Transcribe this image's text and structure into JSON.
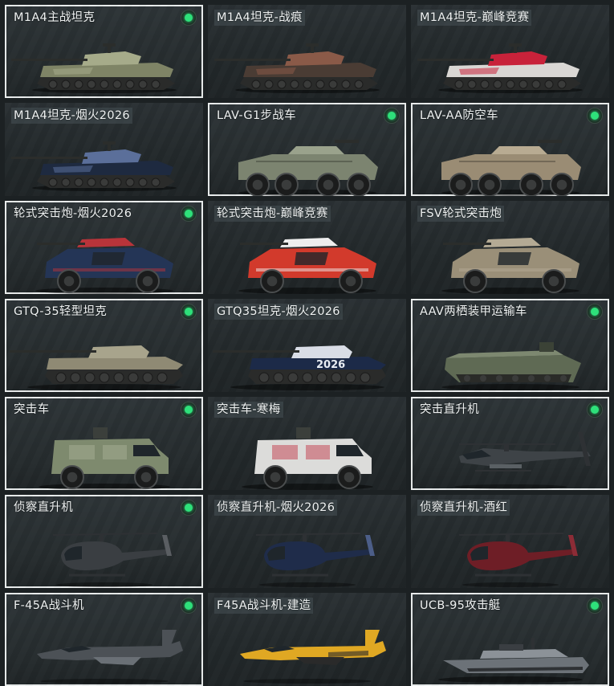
{
  "cards": [
    {
      "name": "M1A4主战坦克",
      "owned": true,
      "type": "tank",
      "color": "#7f8466",
      "accent": "#a6ab8a"
    },
    {
      "name": "M1A4坦克-战痕",
      "owned": false,
      "type": "tank",
      "color": "#4a3c34",
      "accent": "#8a5a48"
    },
    {
      "name": "M1A4坦克-巅峰竞赛",
      "owned": false,
      "type": "tank",
      "color": "#d9d7d4",
      "accent": "#c8223a"
    },
    {
      "name": "M1A4坦克-烟火2026",
      "owned": false,
      "type": "tank",
      "color": "#1e2a40",
      "accent": "#5b6f9a"
    },
    {
      "name": "LAV-G1步战车",
      "owned": true,
      "type": "apc8",
      "color": "#7c8470",
      "accent": "#9aa28c"
    },
    {
      "name": "LAV-AA防空车",
      "owned": true,
      "type": "apc8",
      "color": "#9a8c74",
      "accent": "#b8ab92"
    },
    {
      "name": "轮式突击炮-烟火2026",
      "owned": true,
      "type": "car4",
      "color": "#243556",
      "accent": "#b8343a"
    },
    {
      "name": "轮式突击炮-巅峰竞赛",
      "owned": false,
      "type": "car4",
      "color": "#d23a2c",
      "accent": "#eeeeee"
    },
    {
      "name": "FSV轮式突击炮",
      "owned": false,
      "type": "car4",
      "color": "#9a8f78",
      "accent": "#b4aa94"
    },
    {
      "name": "GTQ-35轻型坦克",
      "owned": true,
      "type": "lighttank",
      "color": "#8f8a74",
      "accent": "#a8a48c"
    },
    {
      "name": "GTQ35坦克-烟火2026",
      "owned": false,
      "type": "lighttank",
      "color": "#1c2a48",
      "accent": "#d9dde6",
      "decal": "2026"
    },
    {
      "name": "AAV两栖装甲运输车",
      "owned": true,
      "type": "amph",
      "color": "#5f6a54",
      "accent": "#7d8870"
    },
    {
      "name": "突击车",
      "owned": true,
      "type": "mrap",
      "color": "#7e8a6e",
      "accent": "#a2ac92"
    },
    {
      "name": "突击车-寒梅",
      "owned": false,
      "type": "mrap",
      "color": "#dcdcda",
      "accent": "#c44a5a"
    },
    {
      "name": "突击直升机",
      "owned": true,
      "type": "heli",
      "color": "#3e4347",
      "accent": "#5a6064"
    },
    {
      "name": "侦察直升机",
      "owned": true,
      "type": "scout",
      "color": "#3a3e42",
      "accent": "#5a5e62"
    },
    {
      "name": "侦察直升机-烟火2026",
      "owned": false,
      "type": "scout",
      "color": "#1f2c4a",
      "accent": "#4c5e88"
    },
    {
      "name": "侦察直升机-酒红",
      "owned": false,
      "type": "scout",
      "color": "#6e1e26",
      "accent": "#8c2c36"
    },
    {
      "name": "F-45A战斗机",
      "owned": true,
      "type": "jet",
      "color": "#4c5156",
      "accent": "#6a7076"
    },
    {
      "name": "F45A战斗机-建造",
      "owned": false,
      "type": "jet",
      "color": "#e0a823",
      "accent": "#2a2a2a"
    },
    {
      "name": "UCB-95攻击艇",
      "owned": true,
      "type": "boat",
      "color": "#6c7278",
      "accent": "#8c9298"
    }
  ]
}
